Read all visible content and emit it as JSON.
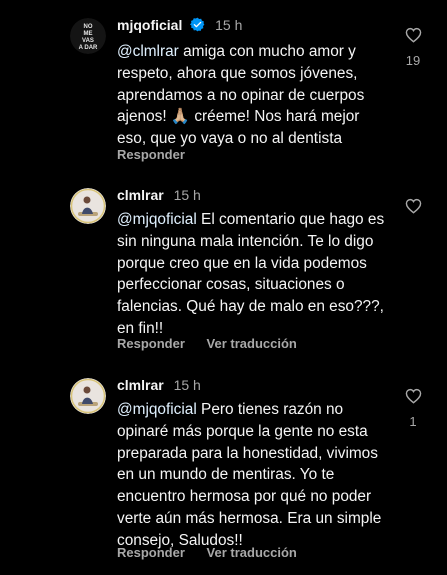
{
  "comments": [
    {
      "username": "mjqoficial",
      "verified": true,
      "time": "15 h",
      "avatar_text": [
        "NO",
        "ME",
        "VAS",
        "A DAR"
      ],
      "mention": "@clmlrar",
      "text": " amiga con mucho amor y respeto, ahora que somos jóvenes, aprendamos a no opinar de cuerpos ajenos! 🙏🏼 créeme! Nos hará mejor eso, que yo vaya o no al dentista",
      "reply_label": "Responder",
      "translate_label": "",
      "likes": "19"
    },
    {
      "username": "clmlrar",
      "verified": false,
      "time": "15 h",
      "mention": "@mjqoficial",
      "text": " El comentario que hago es sin ninguna mala intención. Te lo digo porque creo que en la vida podemos perfeccionar cosas, situaciones o falencias. Qué hay de malo en eso???, en fin!!",
      "reply_label": "Responder",
      "translate_label": "Ver traducción",
      "likes": ""
    },
    {
      "username": "clmlrar",
      "verified": false,
      "time": "15 h",
      "mention": "@mjqoficial",
      "text": " Pero tienes razón no opinaré más porque la gente no esta preparada para la honestidad, vivimos en un mundo de mentiras. Yo te encuentro hermosa por qué no poder verte aún más hermosa. Era un simple consejo,  Saludos!!",
      "reply_label": "Responder",
      "translate_label": "Ver traducción",
      "likes": "1"
    }
  ],
  "colors": {
    "background": "#000000",
    "text": "#f5f5f5",
    "muted": "#a8a8a8",
    "verified": "#0095f6"
  },
  "icons": {
    "like": "heart-outline-icon",
    "verified": "verified-badge-icon"
  }
}
